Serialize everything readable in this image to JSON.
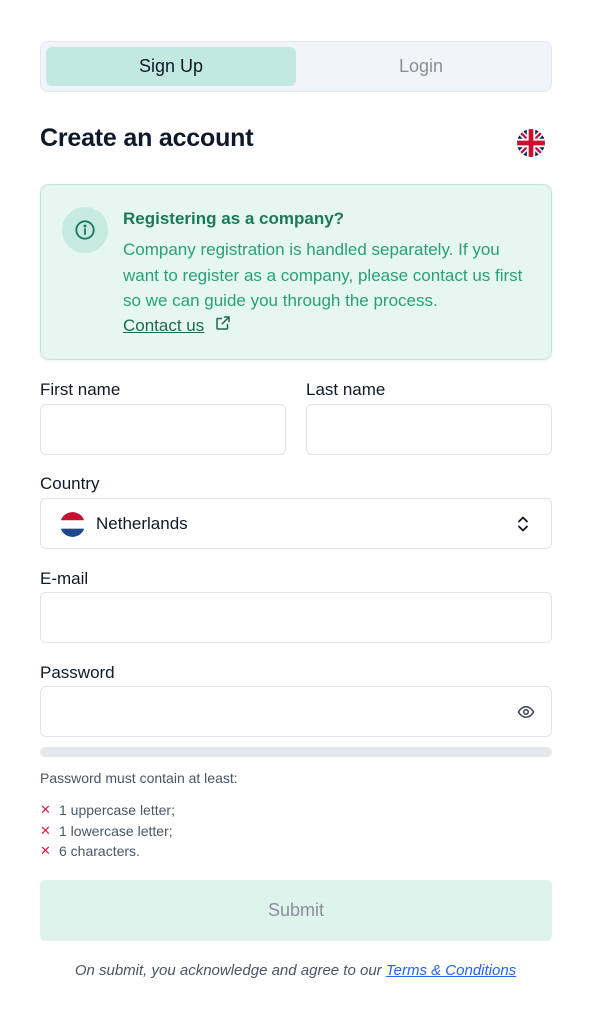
{
  "tabs": [
    {
      "label": "Sign Up",
      "active": true
    },
    {
      "label": "Login",
      "active": false
    }
  ],
  "title": "Create an account",
  "language_flag_icon": "uk-flag-icon",
  "info": {
    "icon": "info-icon",
    "title": "Registering as a company?",
    "body": "Company registration is handled separately. If you want to register as a company, please contact us first so we can guide you through the process.",
    "link_label": "Contact us",
    "link_icon": "external-link-icon"
  },
  "form": {
    "first_name_label": "First name",
    "first_name_value": "",
    "last_name_label": "Last name",
    "last_name_value": "",
    "country_label": "Country",
    "country_value": "Netherlands",
    "country_flag_icon": "netherlands-flag-icon",
    "email_label": "E-mail",
    "email_value": "",
    "password_label": "Password",
    "password_value": "",
    "password_strength": 0,
    "requirements_title": "Password must contain at least:",
    "requirements": [
      "1 uppercase letter;",
      "1 lowercase letter;",
      "6 characters."
    ],
    "submit_label": "Submit"
  },
  "footer": {
    "terms_prefix": "On submit, you acknowledge and agree to our",
    "terms_link": "Terms & Conditions"
  },
  "colors": {
    "accent": "#c1e9df",
    "info_bg": "#e6f6f1",
    "info_text": "#28a07a",
    "error": "#e11d48",
    "link": "#2563eb"
  }
}
